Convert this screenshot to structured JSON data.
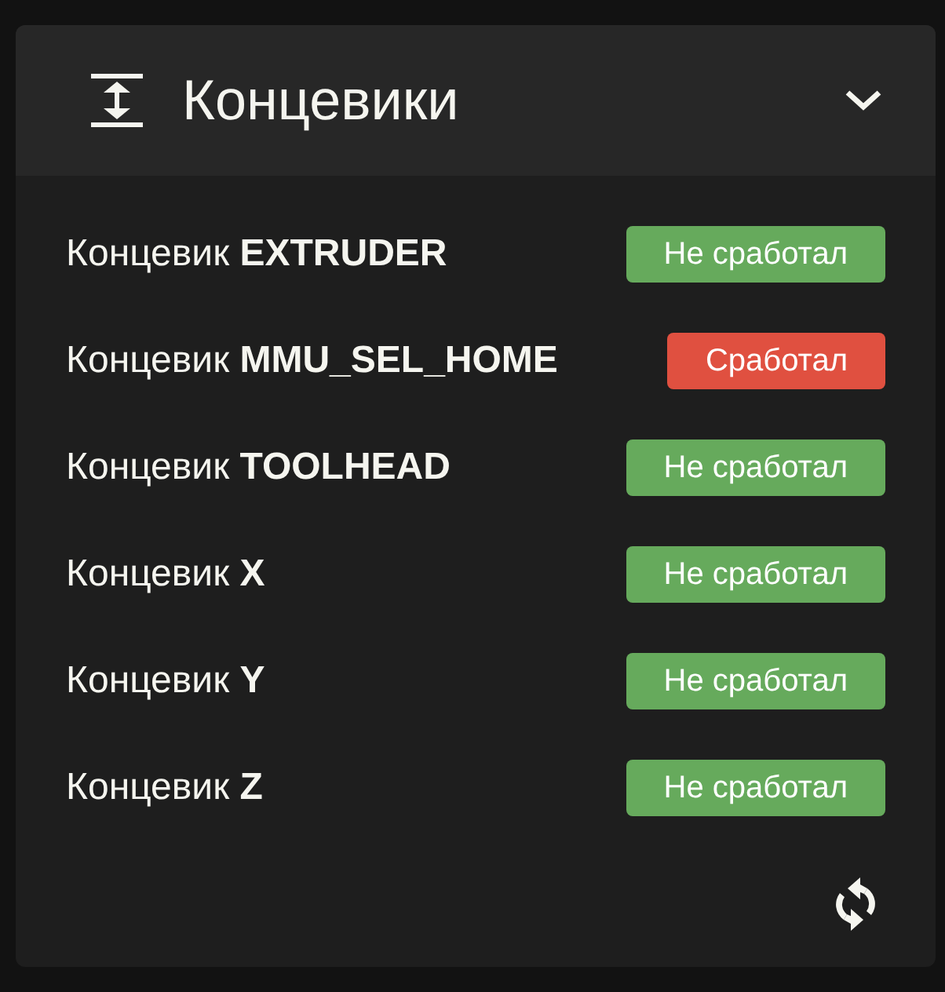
{
  "panel": {
    "title": "Концевики",
    "expanded": true
  },
  "endstops": [
    {
      "label": "Концевик **EXTRUDER**",
      "status": "Не сработал",
      "triggered": false
    },
    {
      "label": "Концевик **MMU_SEL_HOME**",
      "status": "Сработал",
      "triggered": true
    },
    {
      "label": "Концевик **TOOLHEAD**",
      "status": "Не сработал",
      "triggered": false
    },
    {
      "label": "Концевик **X**",
      "status": "Не сработал",
      "triggered": false
    },
    {
      "label": "Концевик **Y**",
      "status": "Не сработал",
      "triggered": false
    },
    {
      "label": "Концевик **Z**",
      "status": "Не сработал",
      "triggered": false
    }
  ]
}
